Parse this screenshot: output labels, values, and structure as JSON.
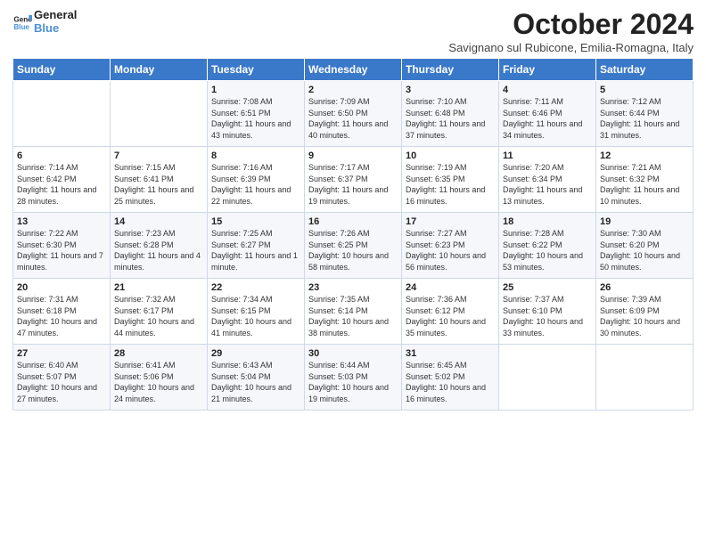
{
  "header": {
    "logo_line1": "General",
    "logo_line2": "Blue",
    "month_title": "October 2024",
    "location": "Savignano sul Rubicone, Emilia-Romagna, Italy"
  },
  "days_of_week": [
    "Sunday",
    "Monday",
    "Tuesday",
    "Wednesday",
    "Thursday",
    "Friday",
    "Saturday"
  ],
  "weeks": [
    [
      {
        "day": "",
        "info": ""
      },
      {
        "day": "",
        "info": ""
      },
      {
        "day": "1",
        "info": "Sunrise: 7:08 AM\nSunset: 6:51 PM\nDaylight: 11 hours and 43 minutes."
      },
      {
        "day": "2",
        "info": "Sunrise: 7:09 AM\nSunset: 6:50 PM\nDaylight: 11 hours and 40 minutes."
      },
      {
        "day": "3",
        "info": "Sunrise: 7:10 AM\nSunset: 6:48 PM\nDaylight: 11 hours and 37 minutes."
      },
      {
        "day": "4",
        "info": "Sunrise: 7:11 AM\nSunset: 6:46 PM\nDaylight: 11 hours and 34 minutes."
      },
      {
        "day": "5",
        "info": "Sunrise: 7:12 AM\nSunset: 6:44 PM\nDaylight: 11 hours and 31 minutes."
      }
    ],
    [
      {
        "day": "6",
        "info": "Sunrise: 7:14 AM\nSunset: 6:42 PM\nDaylight: 11 hours and 28 minutes."
      },
      {
        "day": "7",
        "info": "Sunrise: 7:15 AM\nSunset: 6:41 PM\nDaylight: 11 hours and 25 minutes."
      },
      {
        "day": "8",
        "info": "Sunrise: 7:16 AM\nSunset: 6:39 PM\nDaylight: 11 hours and 22 minutes."
      },
      {
        "day": "9",
        "info": "Sunrise: 7:17 AM\nSunset: 6:37 PM\nDaylight: 11 hours and 19 minutes."
      },
      {
        "day": "10",
        "info": "Sunrise: 7:19 AM\nSunset: 6:35 PM\nDaylight: 11 hours and 16 minutes."
      },
      {
        "day": "11",
        "info": "Sunrise: 7:20 AM\nSunset: 6:34 PM\nDaylight: 11 hours and 13 minutes."
      },
      {
        "day": "12",
        "info": "Sunrise: 7:21 AM\nSunset: 6:32 PM\nDaylight: 11 hours and 10 minutes."
      }
    ],
    [
      {
        "day": "13",
        "info": "Sunrise: 7:22 AM\nSunset: 6:30 PM\nDaylight: 11 hours and 7 minutes."
      },
      {
        "day": "14",
        "info": "Sunrise: 7:23 AM\nSunset: 6:28 PM\nDaylight: 11 hours and 4 minutes."
      },
      {
        "day": "15",
        "info": "Sunrise: 7:25 AM\nSunset: 6:27 PM\nDaylight: 11 hours and 1 minute."
      },
      {
        "day": "16",
        "info": "Sunrise: 7:26 AM\nSunset: 6:25 PM\nDaylight: 10 hours and 58 minutes."
      },
      {
        "day": "17",
        "info": "Sunrise: 7:27 AM\nSunset: 6:23 PM\nDaylight: 10 hours and 56 minutes."
      },
      {
        "day": "18",
        "info": "Sunrise: 7:28 AM\nSunset: 6:22 PM\nDaylight: 10 hours and 53 minutes."
      },
      {
        "day": "19",
        "info": "Sunrise: 7:30 AM\nSunset: 6:20 PM\nDaylight: 10 hours and 50 minutes."
      }
    ],
    [
      {
        "day": "20",
        "info": "Sunrise: 7:31 AM\nSunset: 6:18 PM\nDaylight: 10 hours and 47 minutes."
      },
      {
        "day": "21",
        "info": "Sunrise: 7:32 AM\nSunset: 6:17 PM\nDaylight: 10 hours and 44 minutes."
      },
      {
        "day": "22",
        "info": "Sunrise: 7:34 AM\nSunset: 6:15 PM\nDaylight: 10 hours and 41 minutes."
      },
      {
        "day": "23",
        "info": "Sunrise: 7:35 AM\nSunset: 6:14 PM\nDaylight: 10 hours and 38 minutes."
      },
      {
        "day": "24",
        "info": "Sunrise: 7:36 AM\nSunset: 6:12 PM\nDaylight: 10 hours and 35 minutes."
      },
      {
        "day": "25",
        "info": "Sunrise: 7:37 AM\nSunset: 6:10 PM\nDaylight: 10 hours and 33 minutes."
      },
      {
        "day": "26",
        "info": "Sunrise: 7:39 AM\nSunset: 6:09 PM\nDaylight: 10 hours and 30 minutes."
      }
    ],
    [
      {
        "day": "27",
        "info": "Sunrise: 6:40 AM\nSunset: 5:07 PM\nDaylight: 10 hours and 27 minutes."
      },
      {
        "day": "28",
        "info": "Sunrise: 6:41 AM\nSunset: 5:06 PM\nDaylight: 10 hours and 24 minutes."
      },
      {
        "day": "29",
        "info": "Sunrise: 6:43 AM\nSunset: 5:04 PM\nDaylight: 10 hours and 21 minutes."
      },
      {
        "day": "30",
        "info": "Sunrise: 6:44 AM\nSunset: 5:03 PM\nDaylight: 10 hours and 19 minutes."
      },
      {
        "day": "31",
        "info": "Sunrise: 6:45 AM\nSunset: 5:02 PM\nDaylight: 10 hours and 16 minutes."
      },
      {
        "day": "",
        "info": ""
      },
      {
        "day": "",
        "info": ""
      }
    ]
  ]
}
